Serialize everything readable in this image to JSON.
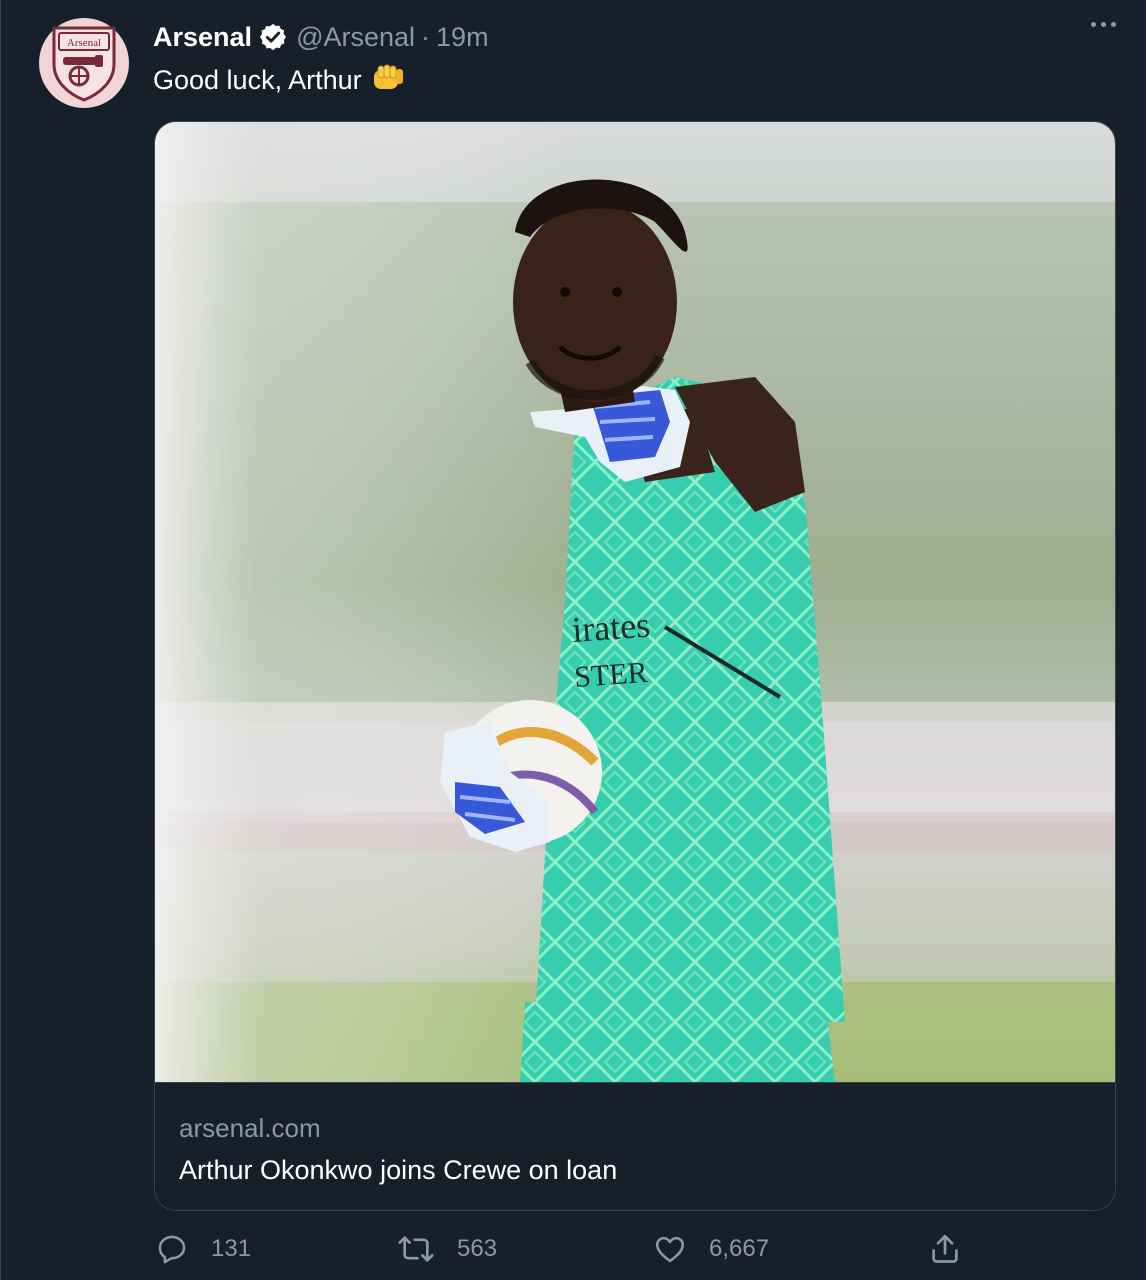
{
  "tweet": {
    "display_name": "Arsenal",
    "handle": "@Arsenal",
    "separator": "·",
    "time": "19m",
    "text": "Good luck, Arthur",
    "emoji": "oncoming-fist-emoji",
    "avatar_icon": "arsenal-crest-icon",
    "avatar_crest_text": "Arsenal",
    "verified_icon": "verified-badge-icon"
  },
  "card": {
    "domain": "arsenal.com",
    "title": "Arthur Okonkwo joins Crewe on loan",
    "image": "goalkeeper-pointing-photo"
  },
  "actions": {
    "reply_count": "131",
    "retweet_count": "563",
    "like_count": "6,667"
  },
  "colors": {
    "background": "#15202b",
    "text_primary": "#ffffff",
    "text_secondary": "#8b98a5",
    "border": "#38444d",
    "avatar_bg": "#f2d3d6",
    "kit_teal": "#3ed3b4"
  }
}
